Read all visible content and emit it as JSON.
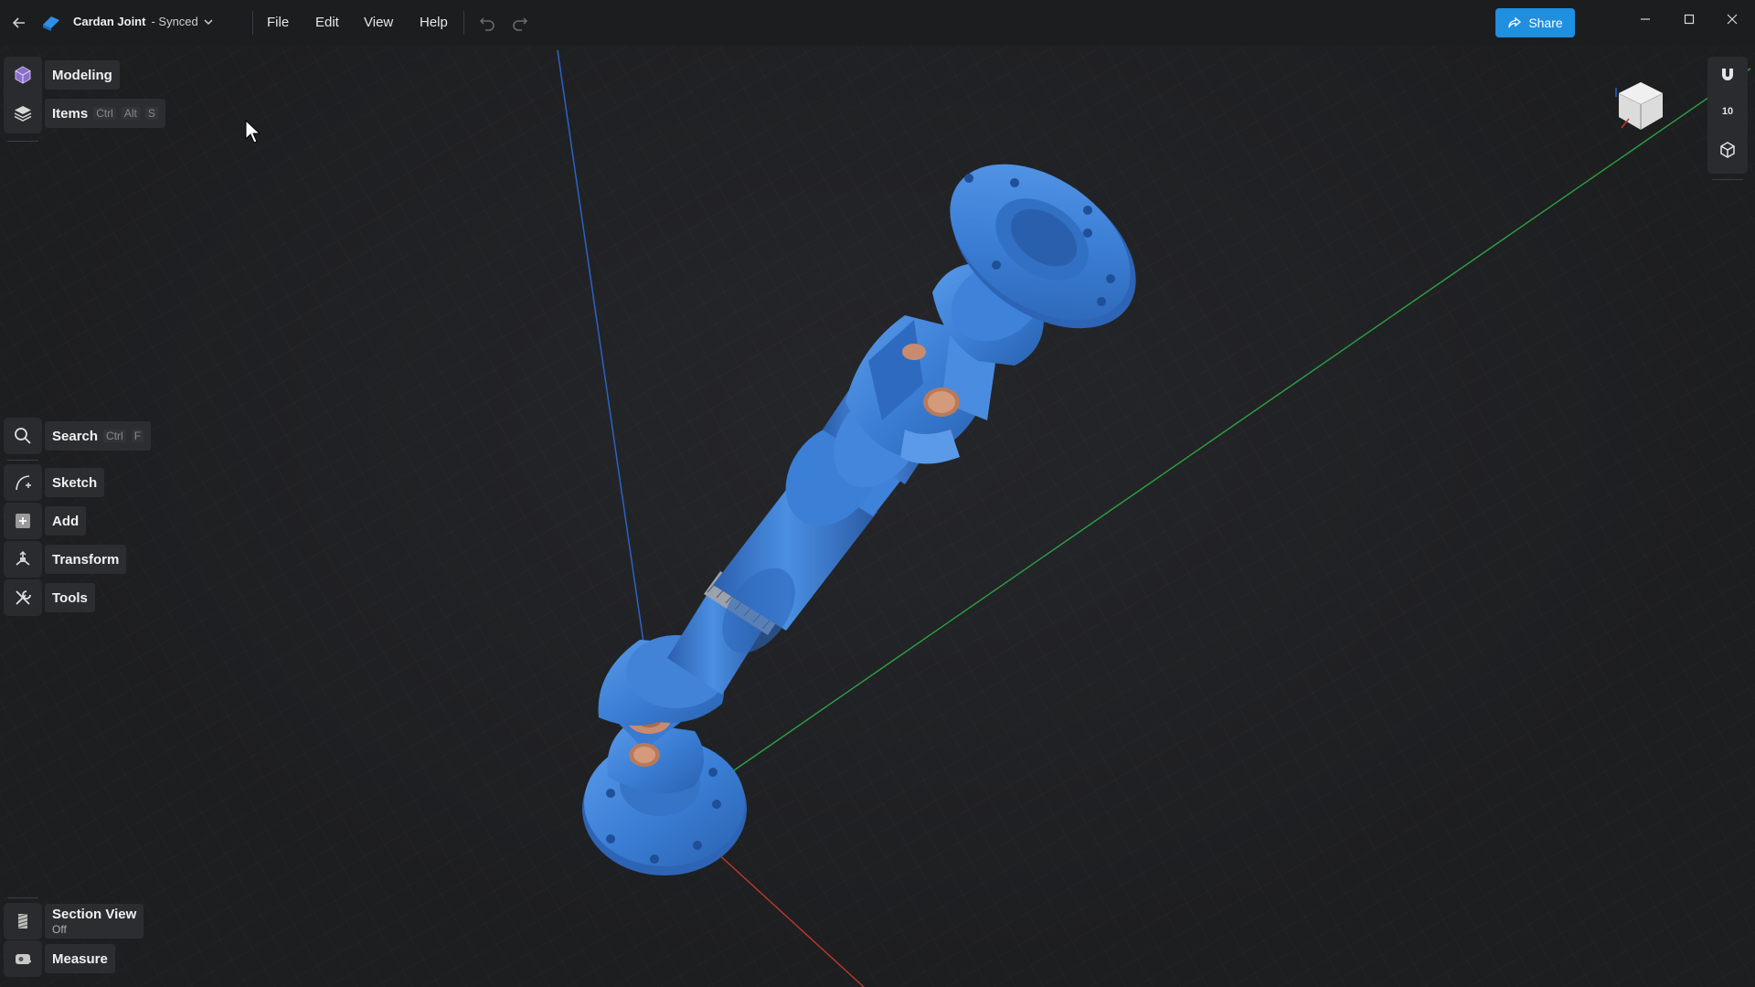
{
  "titlebar": {
    "doc_title": "Cardan Joint",
    "doc_status": "- Synced",
    "menus": [
      "File",
      "Edit",
      "View",
      "Help"
    ],
    "share_label": "Share"
  },
  "left_toolbar": {
    "modeling": "Modeling",
    "items": {
      "label": "Items",
      "keys": [
        "Ctrl",
        "Alt",
        "S"
      ]
    },
    "search": {
      "label": "Search",
      "keys": [
        "Ctrl",
        "F"
      ]
    },
    "sketch": "Sketch",
    "add": "Add",
    "transform": "Transform",
    "tools": "Tools",
    "section_view": {
      "label": "Section View",
      "state": "Off"
    },
    "measure": "Measure"
  },
  "right_toolbar": {
    "grid_value": "10"
  },
  "colors": {
    "accent": "#1f8fe0",
    "model_blue": "#3b7fd6",
    "bearing_copper": "#c98b6d",
    "axis_x": "#c0392b",
    "axis_y": "#2ea043",
    "axis_z": "#2a63c6"
  }
}
